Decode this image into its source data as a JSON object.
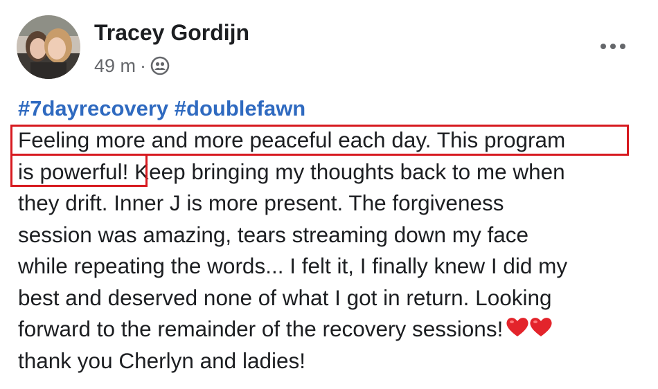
{
  "post": {
    "author": "Tracey Gordijn",
    "time": "49 m",
    "separator": "·",
    "audience_icon": "friends-icon",
    "more_icon": "more-horizontal-icon",
    "hashtags": [
      "#7dayrecovery",
      "#doublefawn"
    ],
    "lines": [
      "Feeling more and more peaceful each day. This program",
      "is powerful!",
      " Keep bringing my thoughts back to me when",
      "they drift. Inner J is more present. The forgiveness",
      "session was amazing, tears streaming down my face",
      "while repeating the words... I felt it, I finally knew I did my",
      "best and deserved none of what I got in return. Looking",
      "forward to the remainder of the recovery sessions!",
      "thank you Cherlyn and ladies!"
    ],
    "emoji": "red-heart-icon",
    "highlight_color": "#d7191f",
    "hashtag_color": "#2f6ac0"
  }
}
